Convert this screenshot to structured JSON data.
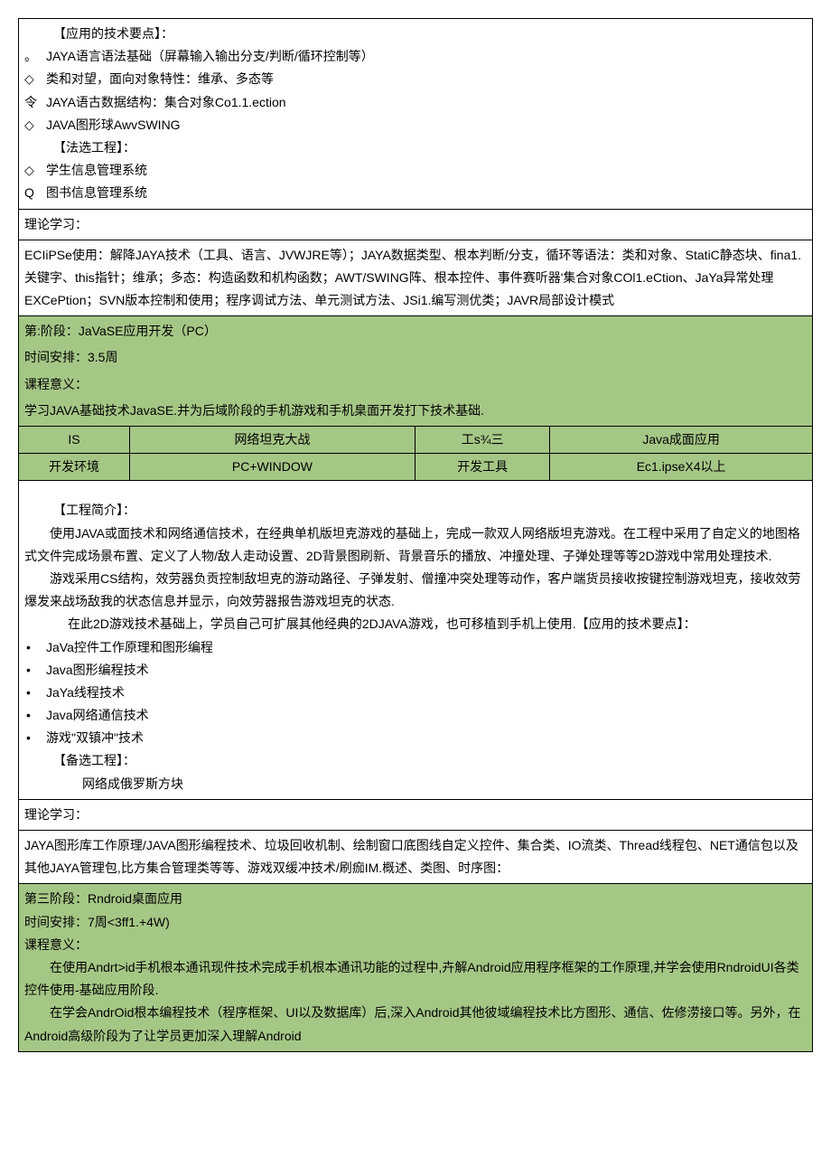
{
  "sec1": {
    "h1": "【应用的技术要点】：",
    "l1b": "。",
    "l1": "JAYA语言语法基础（屏幕输入输出分支/判断/循环控制等）",
    "l2b": "◇",
    "l2": "类和对望，面向对象特性：维承、多态等",
    "l3b": "令",
    "l3": "JAYA语古数据结构：集合对象Co1.1.ection",
    "l4b": "◇",
    "l4": "JAVA图形球AwvSWING",
    "h2": "【法选工程】：",
    "l5b": "◇",
    "l5": "学生信息管理系统",
    "l6b": "Q",
    "l6": "图书信息管理系统"
  },
  "sec2": {
    "title": "理论学习："
  },
  "sec3": {
    "text": "ECIiPSe使用：解降JAYA技术（工具、语言、JVWJRE等）；JAYA数据类型、根本判断/分支，循环等语法：类和对象、StatiC静态块、fina1.关键字、this指针；维承；多态：构造函数和机构函数；AWT/SWING阵、根本控件、事件赛听器'集合对象COl1.eCtion、JaYa异常处理EXCePtion；SVN版本控制和使用；程序调试方法、单元测试方法、JSi1.编写测优类；JAVR局部设计模式"
  },
  "sec4": {
    "l1": "第:阶段：JaVaSE应用开发（PC）",
    "l2": "时间安排：3.5周",
    "l3": "课程意义：",
    "l4": "学习JAVA基础技术JavaSE.并为后域阶段的手机游戏和手机臬面开发打下技术基础."
  },
  "tbl": {
    "r1c1": "IS",
    "r1c2": "网络坦克大战",
    "r1c3": "工s¾三",
    "r1c4": "Java成面应用",
    "r2c1": "开发环境",
    "r2c2": "PC+WINDOW",
    "r2c3": "开发工具",
    "r2c4": "Ec1.ipseX4以上"
  },
  "sec5": {
    "h1": "【工程简介】：",
    "p1": "使用JAVA或面技术和网络通信技术，在经典单机版坦克游戏的基础上，完成一款双人网络版坦克游戏。在工程中采用了自定义的地图格式文件完成场景布置、定义了人物/敌人走动设置、2D背景图刷新、背景音乐的播放、冲撞处理、子弹处理等等2D游戏中常用处理技术.",
    "p2": "游戏采用CS结构，效劳器负贡控制敌坦克的游动路径、子弹发射、僧撞冲突处理等动作，客户端货员接收按键控制游戏坦克，接收效劳爆发来战场敌我的状态信息并显示，向效劳器报告游戏坦克的状态.",
    "p3": "在此2D游戏技术基础上，学员自己可扩展其他经典的2DJAVA游戏，也可移植到手机上使用.【应用的技术要点】：",
    "d1": "JaVa控件工作原理和图形编程",
    "d2": "Java图形编程技术",
    "d3": "JaYa线程技术",
    "d4": "Java网络通信技术",
    "d5": "游戏\"双镇冲\"技术",
    "h2": "【备选工程】：",
    "p4": "网络成俄罗斯方块"
  },
  "sec6": {
    "title": "理论学习："
  },
  "sec7": {
    "text": "JAYA图形库工作原理/JAVA图形编程技术、垃圾回收机制、绘制窗口底图线自定义控件、集合类、IO流类、Thread线程包、NET通信包以及其他JAYA管理包,比方集合管理类等等、游戏双缓冲技术/刷痂IM.概述、类图、时序图："
  },
  "sec8": {
    "l1": "第三阶段：Rndroid桌面应用",
    "l2": "时间安排：7周<3ff1.+4W)",
    "l3": "课程意义：",
    "p1": "在使用Andrt>id手机根本通讯现件技术完成手机根本通讯功能的过程中,卉解Android应用程序框架的工作原理,并学会使用RndroidUI各类控件使用-基础应用阶段.",
    "p2": "在学会AndrOid根本编程技术（程序框架、UI以及数据库）后,深入Android其他彼域编程技术比方图形、通信、佐修涝接口等。另外，在Android高级阶段为了让学员更加深入理解Android"
  }
}
